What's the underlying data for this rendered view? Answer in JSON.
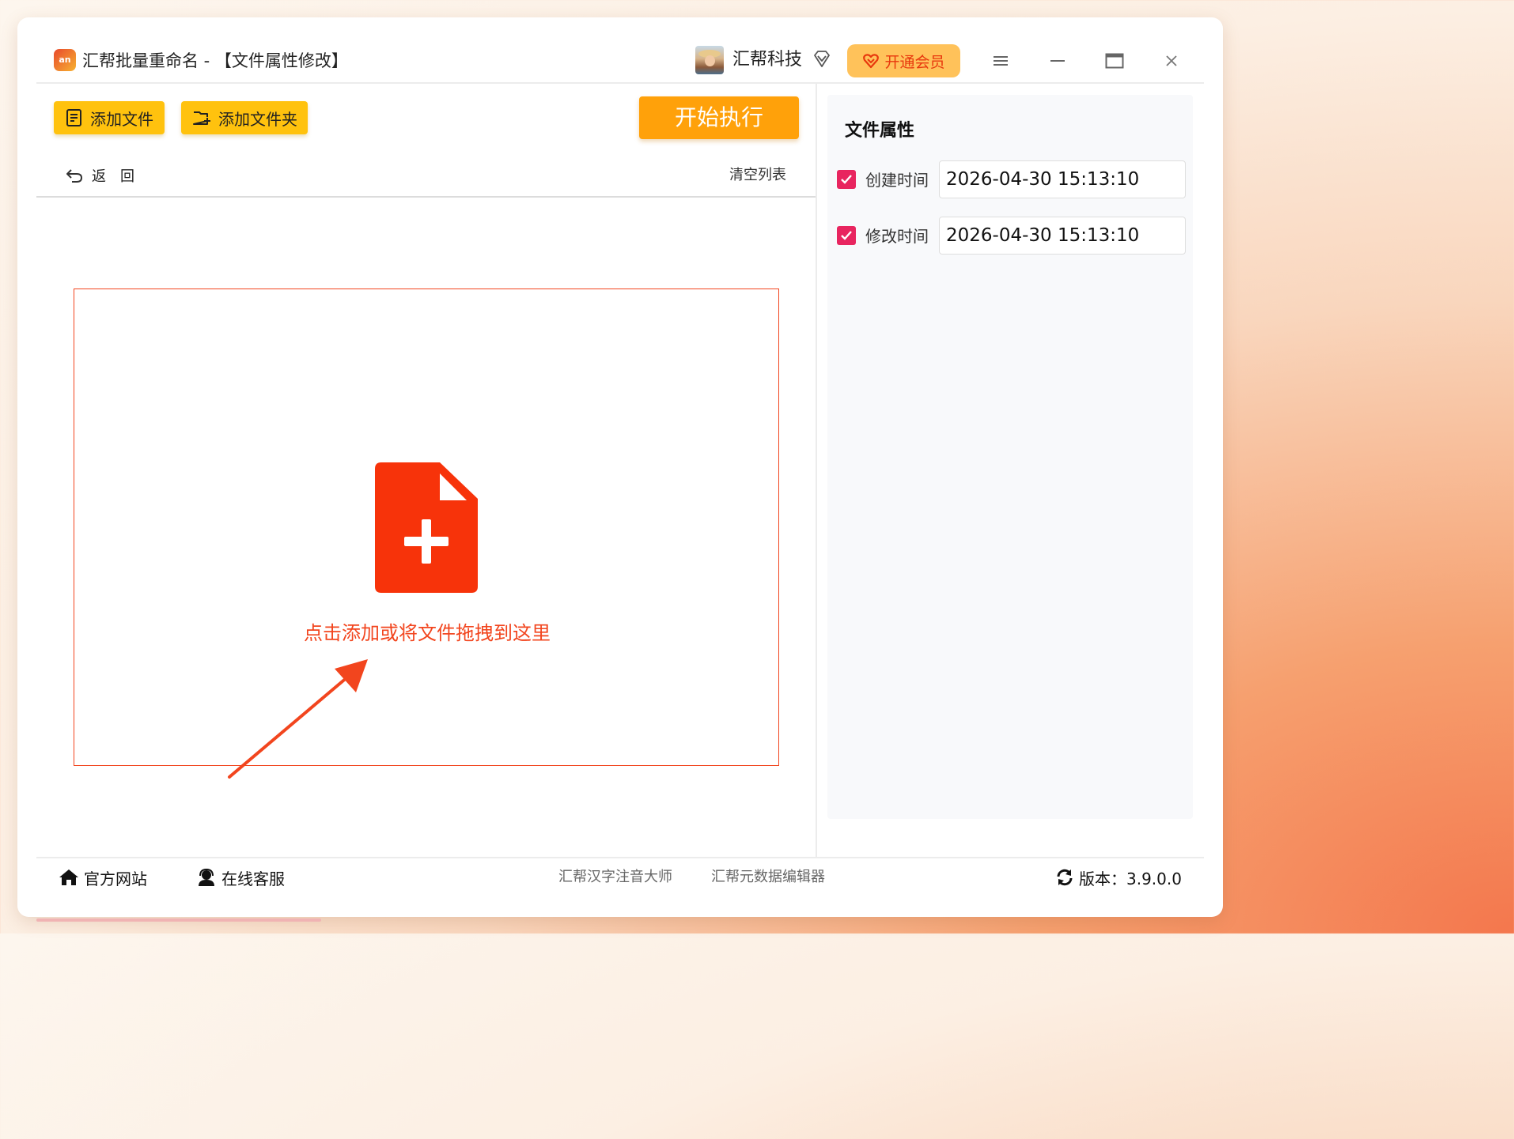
{
  "app": {
    "logo_text": "an",
    "title": "汇帮批量重命名 - 【文件属性修改】",
    "username": "汇帮科技",
    "vip_button": "开通会员"
  },
  "toolbar": {
    "add_file": "添加文件",
    "add_folder": "添加文件夹",
    "start": "开始执行",
    "back": "返　回",
    "clear_list": "清空列表"
  },
  "dropzone": {
    "prompt": "点击添加或将文件拖拽到这里"
  },
  "properties": {
    "title": "文件属性",
    "fields": [
      {
        "label": "创建时间",
        "checked": true,
        "value": "2026-04-30 15:13:10"
      },
      {
        "label": "修改时间",
        "checked": true,
        "value": "2026-04-30 15:13:10"
      }
    ]
  },
  "footer": {
    "website": "官方网站",
    "support": "在线客服",
    "links": [
      "汇帮汉字注音大师",
      "汇帮元数据编辑器"
    ],
    "version": "版本：3.9.0.0"
  },
  "colors": {
    "accent": "#ffc20e",
    "start_button": "#ffa10a",
    "dropzone": "#f2451e",
    "checkbox": "#e8255f",
    "vip_bg": "#ffc25a"
  }
}
